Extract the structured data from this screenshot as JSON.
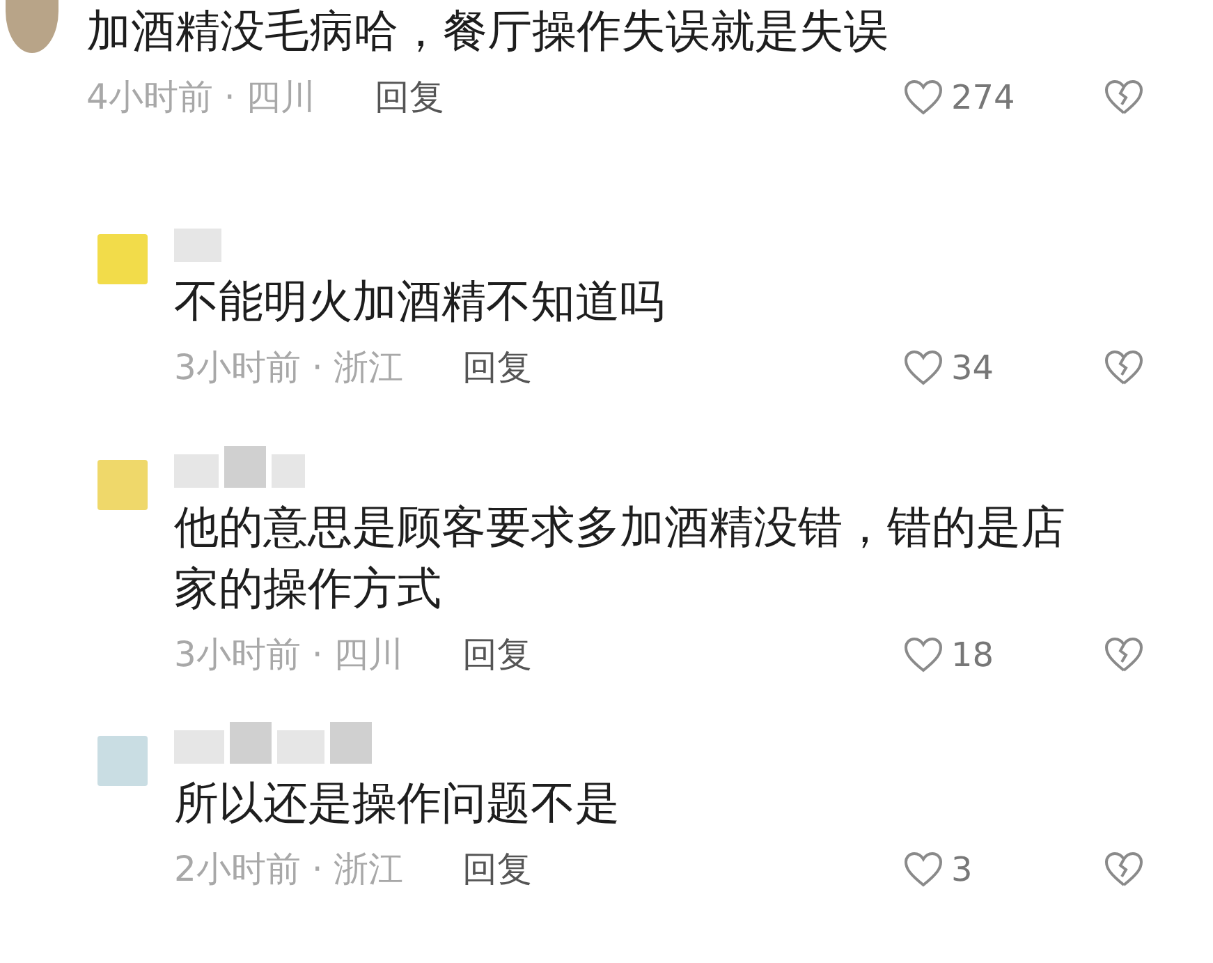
{
  "comments": [
    {
      "kind": "top",
      "color": "#b8a488",
      "text": "加酒精没毛病哈，餐厅操作失误就是失误",
      "time_location": "4小时前 · 四川",
      "reply_label": "回复",
      "likes": "274",
      "liked": false
    },
    {
      "kind": "reply",
      "color": "#f2dc4a",
      "text": "不能明火加酒精不知道吗",
      "time_location": "3小时前 · 浙江",
      "reply_label": "回复",
      "likes": "34",
      "liked": false
    },
    {
      "kind": "reply",
      "color": "#efd86a",
      "text": "他的意思是顾客要求多加酒精没错，错的是店家的操作方式",
      "time_location": "3小时前 · 四川",
      "reply_label": "回复",
      "likes": "18",
      "liked": false
    },
    {
      "kind": "reply",
      "color": "#c9dde3",
      "text": "所以还是操作问题不是",
      "time_location": "2小时前 · 浙江",
      "reply_label": "回复",
      "likes": "3",
      "liked": false
    }
  ]
}
